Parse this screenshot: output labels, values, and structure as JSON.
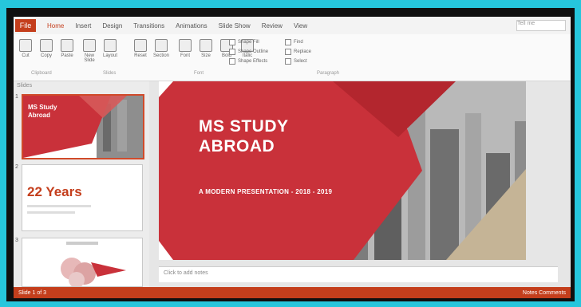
{
  "window": {
    "file_tab": "File",
    "tabs": [
      "Home",
      "Insert",
      "Design",
      "Transitions",
      "Animations",
      "Slide Show",
      "Review",
      "View"
    ],
    "search_placeholder": "Tell me"
  },
  "ribbon": {
    "buttons": [
      "Cut",
      "Copy",
      "Paste",
      "New Slide",
      "Layout",
      "Reset",
      "Section",
      "Font",
      "Size",
      "Bold",
      "Italic"
    ],
    "groups": [
      "Clipboard",
      "Slides",
      "Font",
      "Paragraph"
    ],
    "options": [
      "Shape Fill",
      "Shape Outline",
      "Shape Effects",
      "Find",
      "Replace",
      "Select"
    ]
  },
  "thumbnails": {
    "pane_title": "Slides",
    "slide1": {
      "num": "1",
      "title": "MS Study Abroad"
    },
    "slide2": {
      "num": "2",
      "title": "22 Years"
    },
    "slide3": {
      "num": "3"
    }
  },
  "slide": {
    "title_line1": "MS STUDY",
    "title_line2": "ABROAD",
    "subtitle": "A MODERN PRESENTATION - 2018 - 2019"
  },
  "notes_placeholder": "Click to add notes",
  "status": {
    "left": "Slide 1 of 3",
    "right": "Notes   Comments"
  },
  "colors": {
    "accent": "#c43e1c",
    "slide_red": "#c9313a",
    "frame": "#26c6dc"
  }
}
